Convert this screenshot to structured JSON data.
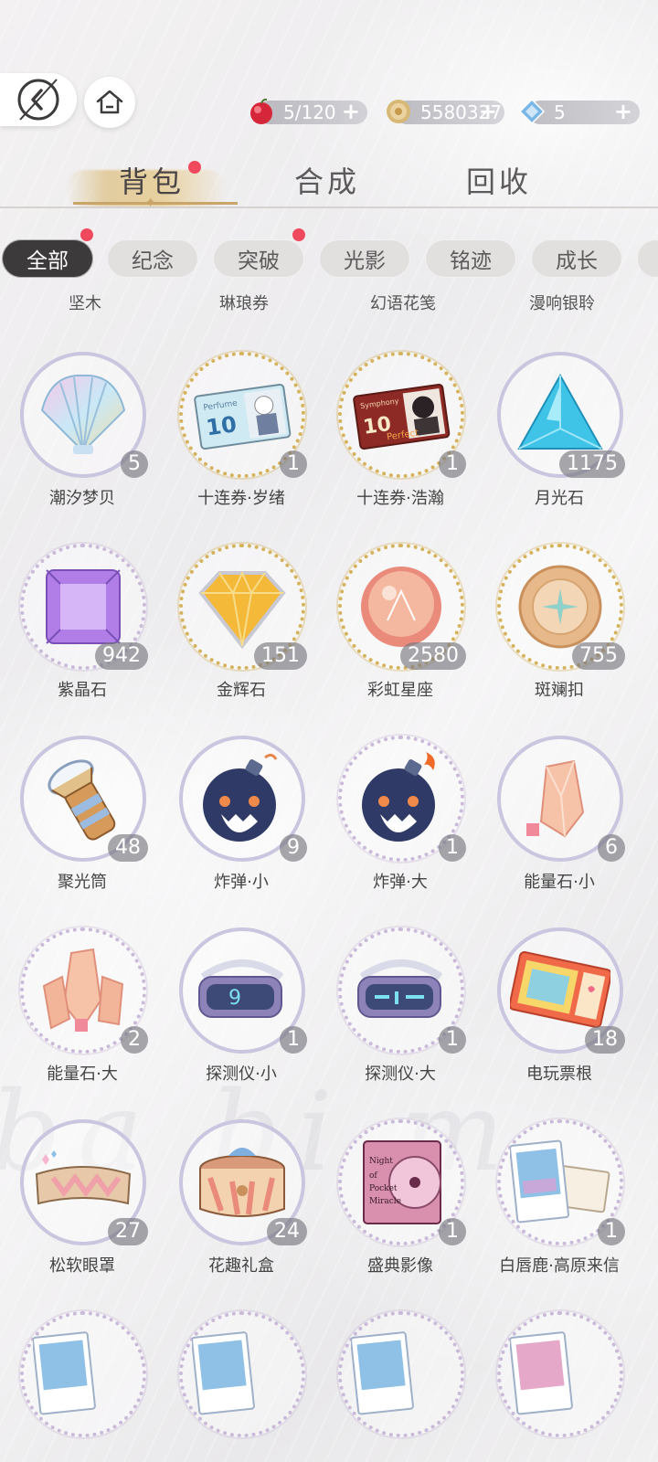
{
  "header": {
    "back_icon": "back-arrow-icon",
    "home_icon": "home-icon",
    "resources": [
      {
        "icon": "apple-icon",
        "value": "5/120",
        "plus": "+",
        "color": "#d6263a"
      },
      {
        "icon": "coin-icon",
        "value": "5580327",
        "plus": "+",
        "color": "#d7b874"
      },
      {
        "icon": "diamond-icon",
        "value": "5",
        "plus": "+",
        "color": "#7ab6e6"
      }
    ]
  },
  "main_tabs": [
    {
      "label": "背包",
      "active": true,
      "badge": true
    },
    {
      "label": "合成",
      "active": false
    },
    {
      "label": "回收",
      "active": false
    }
  ],
  "categories": [
    {
      "label": "全部",
      "active": true,
      "badge": true
    },
    {
      "label": "纪念",
      "active": false
    },
    {
      "label": "突破",
      "active": false,
      "badge": true
    },
    {
      "label": "光影",
      "active": false
    },
    {
      "label": "铭迹",
      "active": false
    },
    {
      "label": "成长",
      "active": false
    }
  ],
  "partial_row": [
    "坚木",
    "琳琅券",
    "幻语花笺",
    "漫响银聆"
  ],
  "items": [
    {
      "name": "潮汐梦贝",
      "count": "5"
    },
    {
      "name": "十连券·岁绪",
      "count": "1"
    },
    {
      "name": "十连券·浩瀚",
      "count": "1"
    },
    {
      "name": "月光石",
      "count": "1175"
    },
    {
      "name": "紫晶石",
      "count": "942"
    },
    {
      "name": "金辉石",
      "count": "151"
    },
    {
      "name": "彩虹星座",
      "count": "2580"
    },
    {
      "name": "斑斓扣",
      "count": "755"
    },
    {
      "name": "聚光筒",
      "count": "48"
    },
    {
      "name": "炸弹·小",
      "count": "9"
    },
    {
      "name": "炸弹·大",
      "count": "1"
    },
    {
      "name": "能量石·小",
      "count": "6"
    },
    {
      "name": "能量石·大",
      "count": "2"
    },
    {
      "name": "探测仪·小",
      "count": "1"
    },
    {
      "name": "探测仪·大",
      "count": "1"
    },
    {
      "name": "电玩票根",
      "count": "18"
    },
    {
      "name": "松软眼罩",
      "count": "27"
    },
    {
      "name": "花趣礼盒",
      "count": "24"
    },
    {
      "name": "盛典影像",
      "count": "1"
    },
    {
      "name": "白唇鹿·高原来信",
      "count": "1"
    }
  ],
  "ticket1": {
    "brand": "Perfume",
    "num": "10"
  },
  "ticket2": {
    "brand": "Symphony",
    "num": "10",
    "sub": "Perfect"
  },
  "cd_text": "Night of Pocket Miracle"
}
